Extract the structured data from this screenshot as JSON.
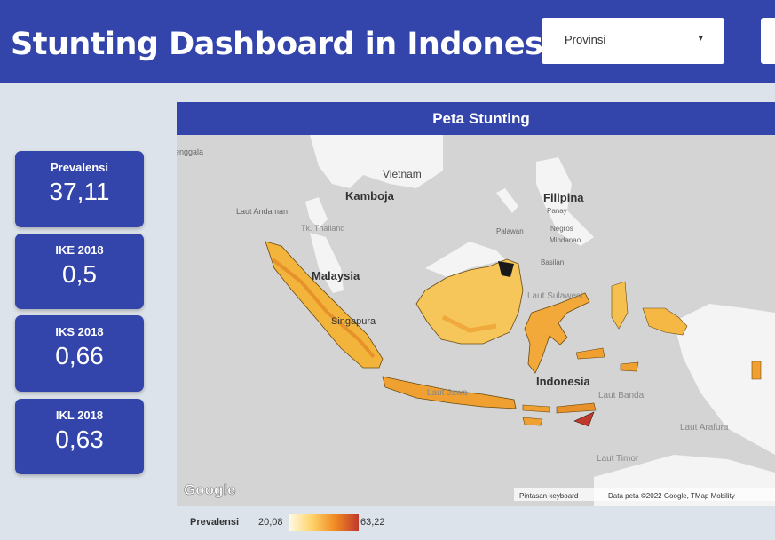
{
  "header": {
    "title": "Stunting Dashboard in Indonesia",
    "dropdown_provinsi": {
      "label": "Provinsi",
      "arrow": "▾"
    }
  },
  "kpis": [
    {
      "label": "Prevalensi",
      "value": "37,11"
    },
    {
      "label": "IKE 2018",
      "value": "0,5"
    },
    {
      "label": "IKS 2018",
      "value": "0,66"
    },
    {
      "label": "IKL 2018",
      "value": "0,63"
    }
  ],
  "map": {
    "title": "Peta Stunting",
    "labels": {
      "vietnam": "Vietnam",
      "kamboja": "Kamboja",
      "filipina": "Filipina",
      "panay": "Panay",
      "negros": "Negros",
      "mindanao": "Mindanao",
      "basilan": "Basilan",
      "palawan": "Palawan",
      "laut_andaman": "Laut Andaman",
      "teluk_thailand": "Tk. Thailand",
      "malaysia": "Malaysia",
      "singapura": "Singapura",
      "laut_sulawesi": "Laut Sulawesi",
      "laut_jawa": "Laut Jawa",
      "indonesia": "Indonesia",
      "laut_banda": "Laut Banda",
      "laut_arafura": "Laut Arafura",
      "laut_timor": "Laut Timor",
      "enggala": "enggala"
    },
    "google_logo": "Google",
    "attribution_shortcuts": "Pintasan keyboard",
    "attribution_data": "Data peta ©2022 Google, TMap Mobility"
  },
  "legend": {
    "title": "Prevalensi",
    "min": "20,08",
    "max": "63,22"
  },
  "colors": {
    "primary": "#3344aa",
    "background": "#dde3ea",
    "map_sea": "#d4d4d4",
    "map_land": "#f4f4f4",
    "choropleth_low": "#fffbe8",
    "choropleth_mid": "#ffd36a",
    "choropleth_high": "#c0392b"
  }
}
